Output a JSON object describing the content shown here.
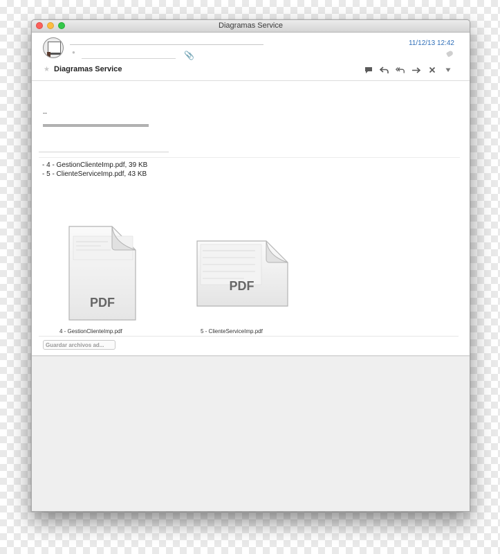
{
  "window": {
    "title": "Diagramas Service"
  },
  "header": {
    "date": "11/12/13 12:42",
    "subject": "Diagramas Service",
    "toolbar": [
      "comment-icon",
      "reply-icon",
      "reply-all-icon",
      "forward-icon",
      "delete-icon",
      "menu-arrow-icon"
    ]
  },
  "body": {
    "signature_dash": "--"
  },
  "attachments": {
    "list": [
      "- 4 - GestionClienteImp.pdf, 39 KB",
      "- 5 - ClienteServiceImp.pdf, 43 KB"
    ],
    "files": [
      {
        "name": "4 - GestionClienteImp.pdf",
        "badge": "PDF"
      },
      {
        "name": "5 - ClienteServiceImp.pdf",
        "badge": "PDF"
      }
    ],
    "save_label": "Guardar archivos ad..."
  },
  "colors": {
    "accent": "#2e6eb8",
    "paperclip": "#a8c76d"
  }
}
